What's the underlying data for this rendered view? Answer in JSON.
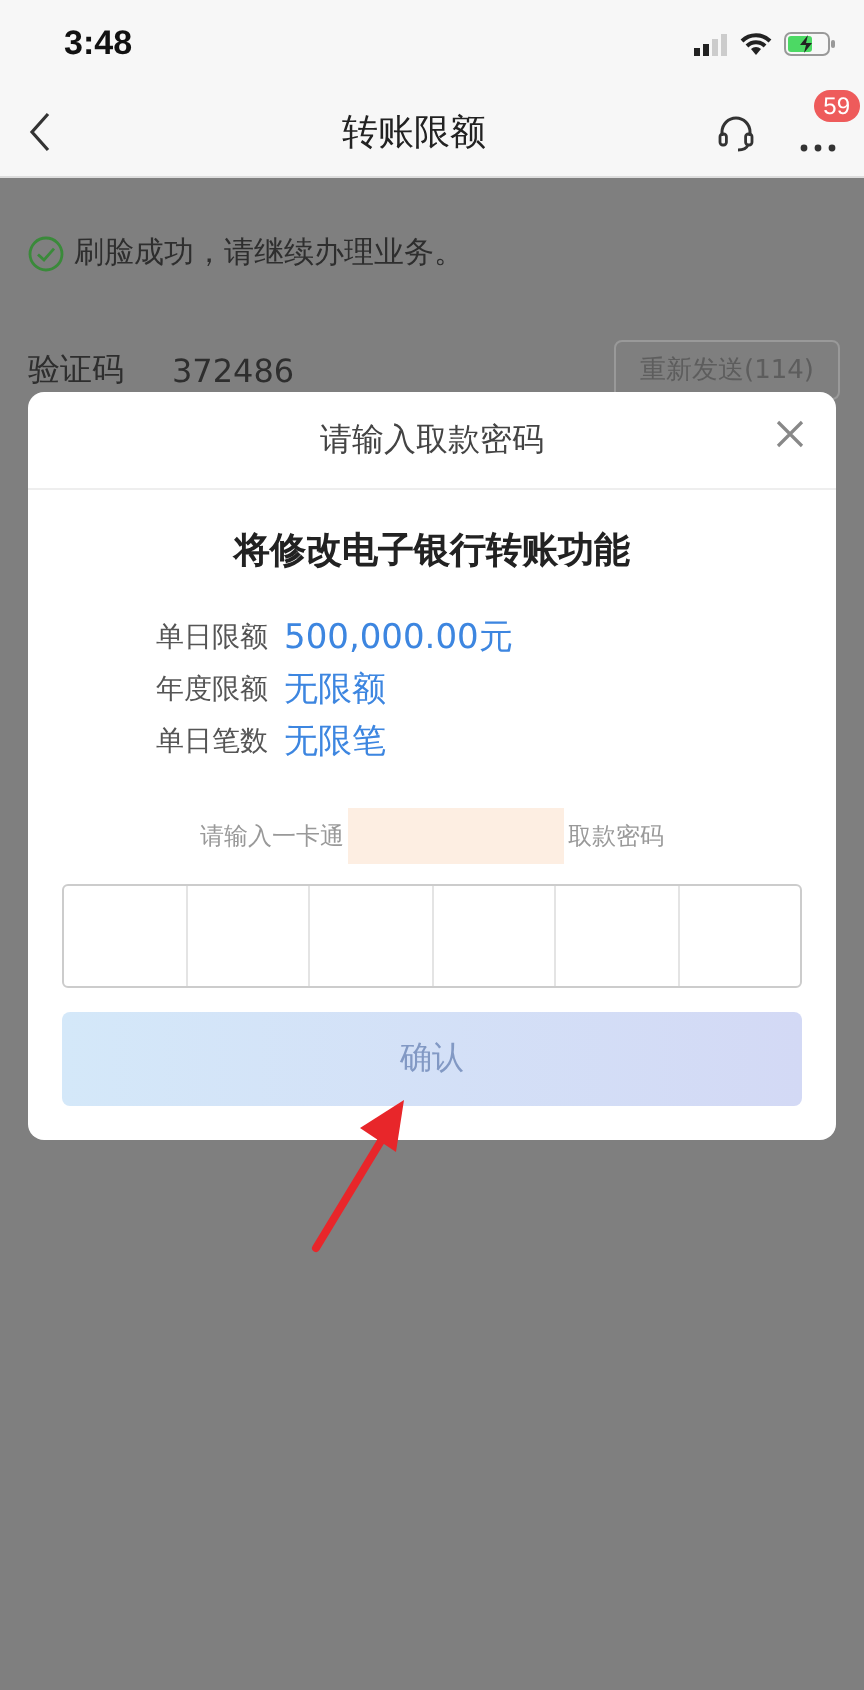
{
  "status_bar": {
    "time": "3:48"
  },
  "nav": {
    "title": "转账限额",
    "badge": "59"
  },
  "background": {
    "notice": "刷脸成功，请继续办理业务。",
    "code_label": "验证码",
    "code_value": "372486",
    "resend": "重新发送(114)"
  },
  "dialog": {
    "title": "请输入取款密码",
    "heading": "将修改电子银行转账功能",
    "limits": [
      {
        "label": "单日限额",
        "value": "500,000.00元"
      },
      {
        "label": "年度限额",
        "value": "无限额"
      },
      {
        "label": "单日笔数",
        "value": "无限笔"
      }
    ],
    "hint_before": "请输入一卡通",
    "hint_after": "取款密码",
    "password_cells": [
      {
        "filled": false
      },
      {
        "filled": false
      },
      {
        "filled": false
      },
      {
        "filled": false
      },
      {
        "filled": false
      },
      {
        "filled": false
      }
    ],
    "confirm": {
      "label": "确认",
      "disabled": true
    }
  }
}
